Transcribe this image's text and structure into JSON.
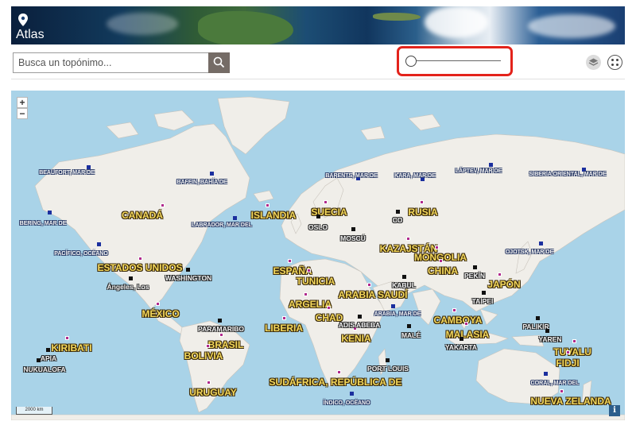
{
  "header": {
    "title": "Atlas"
  },
  "search": {
    "placeholder": "Busca un topónimo..."
  },
  "map_controls": {
    "zoom_in": "+",
    "zoom_out": "−",
    "scale": "2000 km",
    "info": "i"
  },
  "labels": [
    {
      "id": "beaufort",
      "text": "BEAUFORT, MAR DE",
      "kind": "sea"
    },
    {
      "id": "baffin",
      "text": "BAFFIN, BAHÍA DE",
      "kind": "sea"
    },
    {
      "id": "barents",
      "text": "BARENTS, MAR DE",
      "kind": "sea"
    },
    {
      "id": "kara",
      "text": "KARA, MAR DE",
      "kind": "sea"
    },
    {
      "id": "laptev",
      "text": "LÁPTEV, MAR DE",
      "kind": "sea"
    },
    {
      "id": "siberia",
      "text": "SIBERIA ORIENTAL, MAR DE",
      "kind": "sea"
    },
    {
      "id": "bering",
      "text": "BERING, MAR DE",
      "kind": "sea"
    },
    {
      "id": "labrador",
      "text": "LABRADOR, MAR DEL",
      "kind": "sea"
    },
    {
      "id": "pacifico",
      "text": "PACÍFICO, OCÉANO",
      "kind": "sea"
    },
    {
      "id": "ojotsk",
      "text": "OJOTSK, MAR DE",
      "kind": "sea"
    },
    {
      "id": "arabia_mar",
      "text": "ARABIA, MAR DE",
      "kind": "sea"
    },
    {
      "id": "coral",
      "text": "CORAL, MAR DEL",
      "kind": "sea"
    },
    {
      "id": "indico",
      "text": "ÍNDICO, OCÉANO",
      "kind": "sea"
    },
    {
      "id": "canada",
      "text": "CANADÁ",
      "kind": "country"
    },
    {
      "id": "islandia",
      "text": "ISLANDIA",
      "kind": "country"
    },
    {
      "id": "suecia",
      "text": "SUECIA",
      "kind": "country"
    },
    {
      "id": "rusia",
      "text": "RUSIA",
      "kind": "country"
    },
    {
      "id": "eeuu",
      "text": "ESTADOS UNIDOS",
      "kind": "country"
    },
    {
      "id": "kazajstan",
      "text": "KAZAJSTÁN",
      "kind": "country"
    },
    {
      "id": "mongolia",
      "text": "MONGOLIA",
      "kind": "country"
    },
    {
      "id": "espana",
      "text": "ESPAÑA",
      "kind": "country"
    },
    {
      "id": "tunicia",
      "text": "TUNICIA",
      "kind": "country"
    },
    {
      "id": "china",
      "text": "CHINA",
      "kind": "country"
    },
    {
      "id": "japon",
      "text": "JAPÓN",
      "kind": "country"
    },
    {
      "id": "arabia",
      "text": "ARABIA SAUDÍ",
      "kind": "country"
    },
    {
      "id": "argelia",
      "text": "ARGELIA",
      "kind": "country"
    },
    {
      "id": "mexico",
      "text": "MÉXICO",
      "kind": "country"
    },
    {
      "id": "chad",
      "text": "CHAD",
      "kind": "country"
    },
    {
      "id": "camboya",
      "text": "CAMBOYA",
      "kind": "country"
    },
    {
      "id": "liberia",
      "text": "LIBERIA",
      "kind": "country"
    },
    {
      "id": "malasia",
      "text": "MALASIA",
      "kind": "country"
    },
    {
      "id": "kenia",
      "text": "KENIA",
      "kind": "country"
    },
    {
      "id": "brasil",
      "text": "BRASIL",
      "kind": "country"
    },
    {
      "id": "kiribati",
      "text": "KIRIBATI",
      "kind": "country"
    },
    {
      "id": "tuvalu",
      "text": "TUVALU",
      "kind": "country"
    },
    {
      "id": "bolivia",
      "text": "BOLIVIA",
      "kind": "country"
    },
    {
      "id": "fiji",
      "text": "FIDJI",
      "kind": "country"
    },
    {
      "id": "sudafrica",
      "text": "SUDÁFRICA, REPÚBLICA DE",
      "kind": "country"
    },
    {
      "id": "uruguay",
      "text": "URUGUAY",
      "kind": "country"
    },
    {
      "id": "nzelanda",
      "text": "NUEVA ZELANDA",
      "kind": "country"
    },
    {
      "id": "oslo",
      "text": "OSLO",
      "kind": "city"
    },
    {
      "id": "moscu",
      "text": "MOSCÚ",
      "kind": "city"
    },
    {
      "id": "washington",
      "text": "WASHINGTON",
      "kind": "city"
    },
    {
      "id": "angeles",
      "text": "Ángeles, Los",
      "kind": "city"
    },
    {
      "id": "pekin",
      "text": "PEKÍN",
      "kind": "city"
    },
    {
      "id": "kabul",
      "text": "KABUL",
      "kind": "city"
    },
    {
      "id": "taipei",
      "text": "TAIPEI",
      "kind": "city"
    },
    {
      "id": "paramaribo",
      "text": "PARAMARIBO",
      "kind": "city"
    },
    {
      "id": "addis",
      "text": "ADIS ABEBA",
      "kind": "city"
    },
    {
      "id": "male",
      "text": "MALÉ",
      "kind": "city"
    },
    {
      "id": "palikir",
      "text": "PALIKIR",
      "kind": "city"
    },
    {
      "id": "yaren",
      "text": "YAREN",
      "kind": "city"
    },
    {
      "id": "yakarta",
      "text": "YAKARTA",
      "kind": "city"
    },
    {
      "id": "apia",
      "text": "APIA",
      "kind": "city"
    },
    {
      "id": "nukualofa",
      "text": "NUKUALOFA",
      "kind": "city"
    },
    {
      "id": "portlouis",
      "text": "PORT LOUIS",
      "kind": "city"
    },
    {
      "id": "co",
      "text": "CO",
      "kind": "city"
    }
  ]
}
